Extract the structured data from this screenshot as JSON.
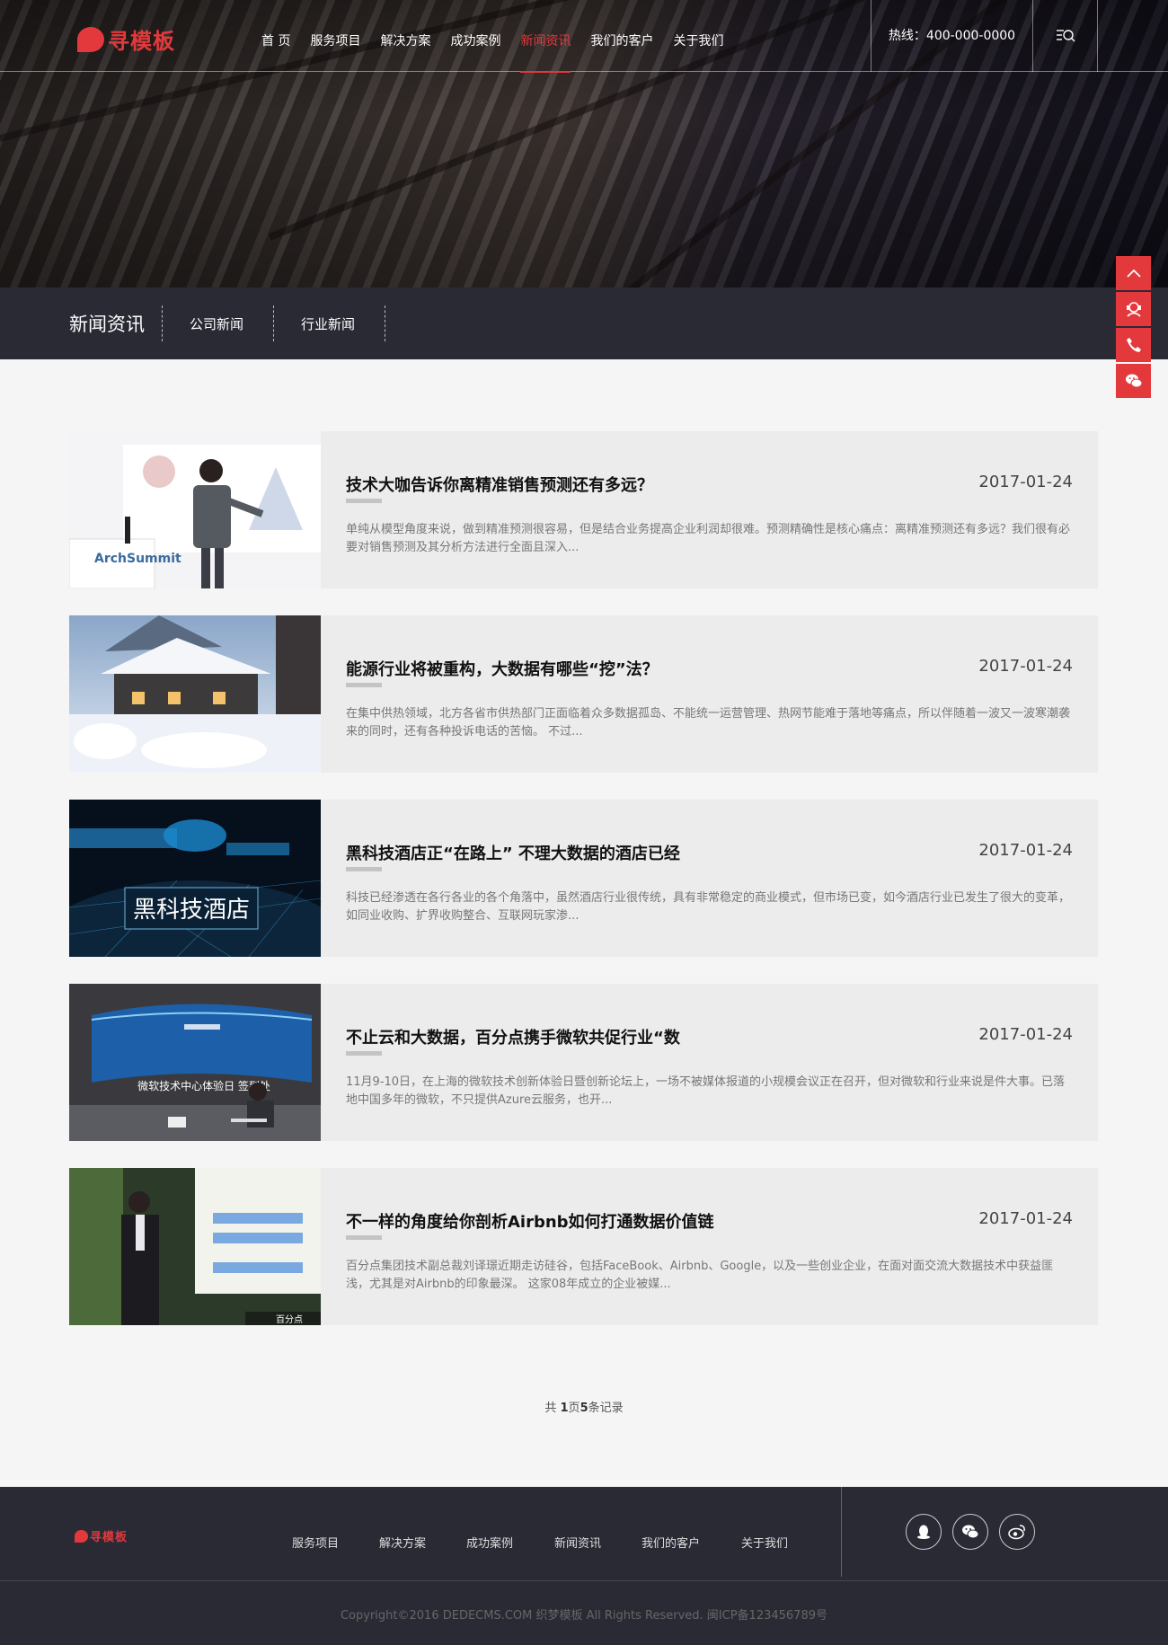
{
  "header": {
    "logo_text": "寻模板",
    "nav": [
      "首 页",
      "服务项目",
      "解决方案",
      "成功案例",
      "新闻资讯",
      "我们的客户",
      "关于我们"
    ],
    "active_nav": "新闻资讯",
    "hotline": "热线：400-000-0000",
    "search_icon": "search-icon"
  },
  "subnav": {
    "title": "新闻资讯",
    "links": [
      "公司新闻",
      "行业新闻"
    ]
  },
  "side_buttons": [
    "arrow-up-icon",
    "customer-service-icon",
    "phone-icon",
    "wechat-icon"
  ],
  "articles": [
    {
      "title": "技术大咖告诉你离精准销售预测还有多远？",
      "date": "2017-01-24",
      "desc": "单纯从模型角度来说，做到精准预测很容易，但是结合业务提高企业利润却很难。预测精确性是核心痛点：离精准预测还有多远？我们很有必要对销售预测及其分析方法进行全面且深入...",
      "thumb_text": "ArchSummit"
    },
    {
      "title": "能源行业将被重构，大数据有哪些“挖”法？",
      "date": "2017-01-24",
      "desc": "在集中供热领域，北方各省市供热部门正面临着众多数据孤岛、不能统一运营管理、热网节能难于落地等痛点，所以伴随着一波又一波寒潮袭来的同时，还有各种投诉电话的苦恼。 不过...",
      "thumb_text": ""
    },
    {
      "title": "黑科技酒店正“在路上” 不理大数据的酒店已经",
      "date": "2017-01-24",
      "desc": "科技已经渗透在各行各业的各个角落中，虽然酒店行业很传统，具有非常稳定的商业模式，但市场已变，如今酒店行业已发生了很大的变革，如同业收购、扩界收购整合、互联网玩家渗...",
      "thumb_text": "黑科技酒店"
    },
    {
      "title": "不止云和大数据，百分点携手微软共促行业“数",
      "date": "2017-01-24",
      "desc": "11月9-10日，在上海的微软技术创新体验日暨创新论坛上，一场不被媒体报道的小规模会议正在召开，但对微软和行业来说是件大事。已落地中国多年的微软，不只提供Azure云服务，也开...",
      "thumb_text": "微软技术中心体验日 签到处"
    },
    {
      "title": "不一样的角度给你剖析Airbnb如何打通数据价值链",
      "date": "2017-01-24",
      "desc": "百分点集团技术副总裁刘译璟近期走访硅谷，包括FaceBook、Airbnb、Google，以及一些创业企业，在面对面交流大数据技术中获益匪浅，尤其是对Airbnb的印象最深。 这家08年成立的企业被媒...",
      "thumb_text": "百分点"
    }
  ],
  "pager": {
    "prefix": "共 ",
    "pages": "1",
    "mid": "页",
    "records": "5",
    "suffix": "条记录"
  },
  "footer": {
    "logo_text": "寻模板",
    "nav": [
      "服务项目",
      "解决方案",
      "成功案例",
      "新闻资讯",
      "我们的客户",
      "关于我们"
    ],
    "social": [
      "qq-icon",
      "wechat-icon",
      "weibo-icon"
    ],
    "copyright": "Copyright©2016 DEDECMS.COM 织梦模板 All Rights Reserved.  闽ICP备123456789号"
  },
  "colors": {
    "accent": "#e4393c",
    "dark_bg": "#2a2a35",
    "page_bg": "#f5f5f5",
    "card_bg": "#ececec"
  }
}
